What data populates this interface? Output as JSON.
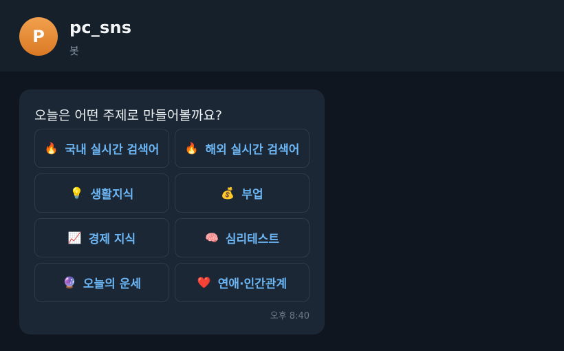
{
  "header": {
    "avatar_letter": "P",
    "name": "pc_sns",
    "subtitle": "봇"
  },
  "message": {
    "question": "오늘은 어떤 주제로 만들어볼까요?",
    "time": "오후 8:40",
    "buttons": [
      {
        "icon": "fire-icon",
        "emoji": "🔥",
        "label": "국내 실시간 검색어"
      },
      {
        "icon": "fire-icon",
        "emoji": "🔥",
        "label": "해외 실시간 검색어"
      },
      {
        "icon": "lightbulb-icon",
        "emoji": "💡",
        "label": "생활지식"
      },
      {
        "icon": "money-bag-icon",
        "emoji": "💰",
        "label": "부업"
      },
      {
        "icon": "chart-increasing-icon",
        "emoji": "📈",
        "label": "경제 지식"
      },
      {
        "icon": "brain-icon",
        "emoji": "🧠",
        "label": "심리테스트"
      },
      {
        "icon": "crystal-ball-icon",
        "emoji": "🔮",
        "label": "오늘의 운세"
      },
      {
        "icon": "heart-icon",
        "emoji": "❤️",
        "label": "연애·인간관계"
      }
    ]
  },
  "colors": {
    "background": "#0f161f",
    "header": "#16202a",
    "bubble": "#1b2734",
    "button_text": "#6cb6f5",
    "avatar": "#e8913e"
  }
}
